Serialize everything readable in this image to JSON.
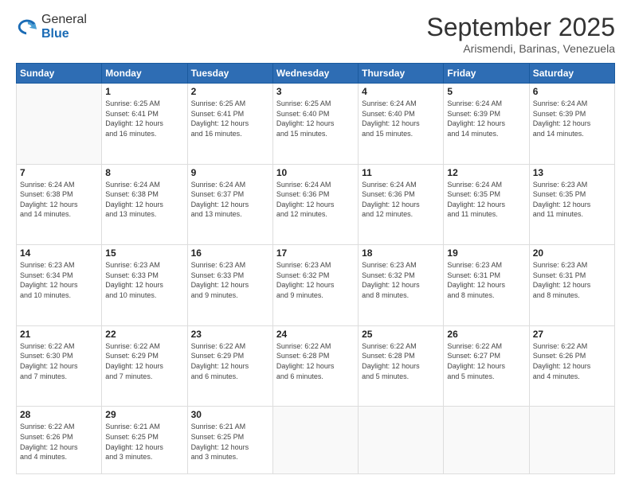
{
  "logo": {
    "general": "General",
    "blue": "Blue"
  },
  "header": {
    "title": "September 2025",
    "subtitle": "Arismendi, Barinas, Venezuela"
  },
  "days_of_week": [
    "Sunday",
    "Monday",
    "Tuesday",
    "Wednesday",
    "Thursday",
    "Friday",
    "Saturday"
  ],
  "weeks": [
    [
      {
        "day": "",
        "info": ""
      },
      {
        "day": "1",
        "info": "Sunrise: 6:25 AM\nSunset: 6:41 PM\nDaylight: 12 hours\nand 16 minutes."
      },
      {
        "day": "2",
        "info": "Sunrise: 6:25 AM\nSunset: 6:41 PM\nDaylight: 12 hours\nand 16 minutes."
      },
      {
        "day": "3",
        "info": "Sunrise: 6:25 AM\nSunset: 6:40 PM\nDaylight: 12 hours\nand 15 minutes."
      },
      {
        "day": "4",
        "info": "Sunrise: 6:24 AM\nSunset: 6:40 PM\nDaylight: 12 hours\nand 15 minutes."
      },
      {
        "day": "5",
        "info": "Sunrise: 6:24 AM\nSunset: 6:39 PM\nDaylight: 12 hours\nand 14 minutes."
      },
      {
        "day": "6",
        "info": "Sunrise: 6:24 AM\nSunset: 6:39 PM\nDaylight: 12 hours\nand 14 minutes."
      }
    ],
    [
      {
        "day": "7",
        "info": "Sunrise: 6:24 AM\nSunset: 6:38 PM\nDaylight: 12 hours\nand 14 minutes."
      },
      {
        "day": "8",
        "info": "Sunrise: 6:24 AM\nSunset: 6:38 PM\nDaylight: 12 hours\nand 13 minutes."
      },
      {
        "day": "9",
        "info": "Sunrise: 6:24 AM\nSunset: 6:37 PM\nDaylight: 12 hours\nand 13 minutes."
      },
      {
        "day": "10",
        "info": "Sunrise: 6:24 AM\nSunset: 6:36 PM\nDaylight: 12 hours\nand 12 minutes."
      },
      {
        "day": "11",
        "info": "Sunrise: 6:24 AM\nSunset: 6:36 PM\nDaylight: 12 hours\nand 12 minutes."
      },
      {
        "day": "12",
        "info": "Sunrise: 6:24 AM\nSunset: 6:35 PM\nDaylight: 12 hours\nand 11 minutes."
      },
      {
        "day": "13",
        "info": "Sunrise: 6:23 AM\nSunset: 6:35 PM\nDaylight: 12 hours\nand 11 minutes."
      }
    ],
    [
      {
        "day": "14",
        "info": "Sunrise: 6:23 AM\nSunset: 6:34 PM\nDaylight: 12 hours\nand 10 minutes."
      },
      {
        "day": "15",
        "info": "Sunrise: 6:23 AM\nSunset: 6:33 PM\nDaylight: 12 hours\nand 10 minutes."
      },
      {
        "day": "16",
        "info": "Sunrise: 6:23 AM\nSunset: 6:33 PM\nDaylight: 12 hours\nand 9 minutes."
      },
      {
        "day": "17",
        "info": "Sunrise: 6:23 AM\nSunset: 6:32 PM\nDaylight: 12 hours\nand 9 minutes."
      },
      {
        "day": "18",
        "info": "Sunrise: 6:23 AM\nSunset: 6:32 PM\nDaylight: 12 hours\nand 8 minutes."
      },
      {
        "day": "19",
        "info": "Sunrise: 6:23 AM\nSunset: 6:31 PM\nDaylight: 12 hours\nand 8 minutes."
      },
      {
        "day": "20",
        "info": "Sunrise: 6:23 AM\nSunset: 6:31 PM\nDaylight: 12 hours\nand 8 minutes."
      }
    ],
    [
      {
        "day": "21",
        "info": "Sunrise: 6:22 AM\nSunset: 6:30 PM\nDaylight: 12 hours\nand 7 minutes."
      },
      {
        "day": "22",
        "info": "Sunrise: 6:22 AM\nSunset: 6:29 PM\nDaylight: 12 hours\nand 7 minutes."
      },
      {
        "day": "23",
        "info": "Sunrise: 6:22 AM\nSunset: 6:29 PM\nDaylight: 12 hours\nand 6 minutes."
      },
      {
        "day": "24",
        "info": "Sunrise: 6:22 AM\nSunset: 6:28 PM\nDaylight: 12 hours\nand 6 minutes."
      },
      {
        "day": "25",
        "info": "Sunrise: 6:22 AM\nSunset: 6:28 PM\nDaylight: 12 hours\nand 5 minutes."
      },
      {
        "day": "26",
        "info": "Sunrise: 6:22 AM\nSunset: 6:27 PM\nDaylight: 12 hours\nand 5 minutes."
      },
      {
        "day": "27",
        "info": "Sunrise: 6:22 AM\nSunset: 6:26 PM\nDaylight: 12 hours\nand 4 minutes."
      }
    ],
    [
      {
        "day": "28",
        "info": "Sunrise: 6:22 AM\nSunset: 6:26 PM\nDaylight: 12 hours\nand 4 minutes."
      },
      {
        "day": "29",
        "info": "Sunrise: 6:21 AM\nSunset: 6:25 PM\nDaylight: 12 hours\nand 3 minutes."
      },
      {
        "day": "30",
        "info": "Sunrise: 6:21 AM\nSunset: 6:25 PM\nDaylight: 12 hours\nand 3 minutes."
      },
      {
        "day": "",
        "info": ""
      },
      {
        "day": "",
        "info": ""
      },
      {
        "day": "",
        "info": ""
      },
      {
        "day": "",
        "info": ""
      }
    ]
  ]
}
